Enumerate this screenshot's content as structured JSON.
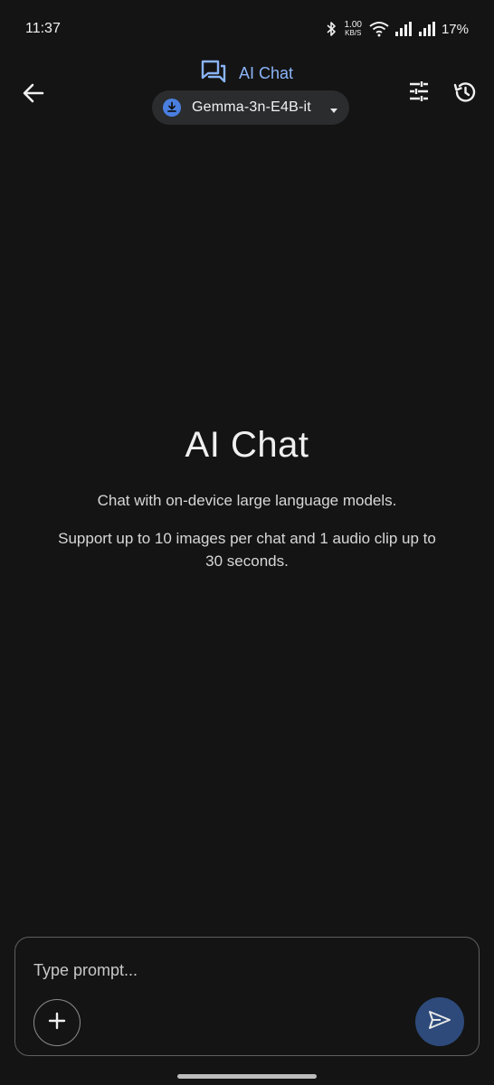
{
  "status_bar": {
    "time": "11:37",
    "net_speed_value": "1.00",
    "net_speed_unit": "KB/S",
    "battery": "17%"
  },
  "header": {
    "title": "AI Chat",
    "model_name": "Gemma-3n-E4B-it",
    "icons": {
      "back": "arrow-back-icon",
      "title": "chat-bubbles-icon",
      "model": "download-icon",
      "dropdown": "caret-down-icon",
      "settings": "tune-sliders-icon",
      "history": "history-icon"
    }
  },
  "hero": {
    "title": "AI Chat",
    "line1": "Chat with on-device large language models.",
    "line2": "Support up to 10 images per chat and 1 audio clip up to 30 seconds."
  },
  "input": {
    "placeholder": "Type prompt...",
    "icons": {
      "add": "plus-icon",
      "send": "send-icon"
    }
  },
  "colors": {
    "background": "#141414",
    "accent": "#8ab4f8",
    "chip_background": "#2a2c2e",
    "download_icon": "#4a7fe0",
    "send_button": "#2d4a7a"
  }
}
